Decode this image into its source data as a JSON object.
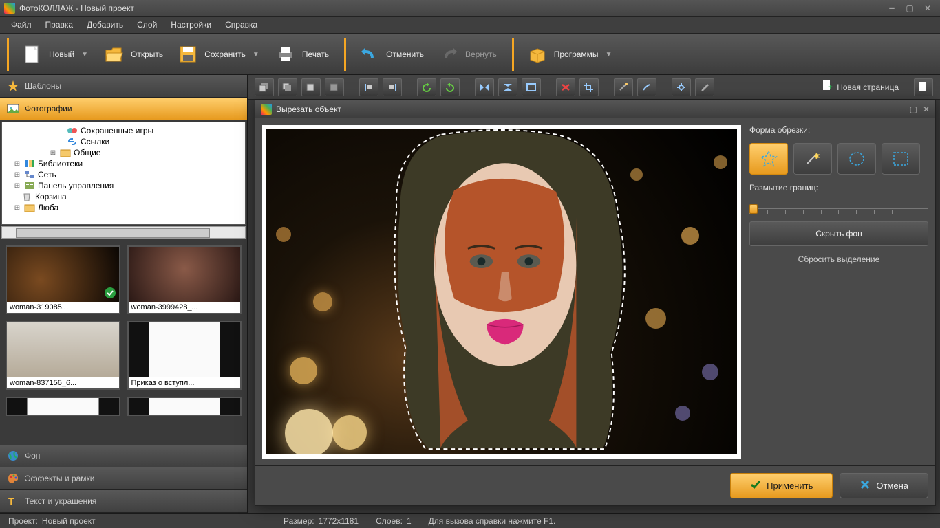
{
  "title": "ФотоКОЛЛАЖ - Новый проект",
  "menu": [
    "Файл",
    "Правка",
    "Добавить",
    "Слой",
    "Настройки",
    "Справка"
  ],
  "toolbar": {
    "new": "Новый",
    "open": "Открыть",
    "save": "Сохранить",
    "print": "Печать",
    "undo": "Отменить",
    "redo": "Вернуть",
    "programs": "Программы"
  },
  "left": {
    "templates": "Шаблоны",
    "photos": "Фотографии",
    "background": "Фон",
    "effects": "Эффекты и рамки",
    "text": "Текст и украшения",
    "tree": {
      "saved_games": "Сохраненные игры",
      "links": "Ссылки",
      "shared": "Общие",
      "libraries": "Библиотеки",
      "network": "Сеть",
      "control_panel": "Панель управления",
      "recycle": "Корзина",
      "lyuba": "Люба"
    },
    "thumbs": [
      "woman-319085...",
      "woman-3999428_...",
      "woman-837156_6...",
      "Приказ о вступл..."
    ]
  },
  "canvasToolbar": {
    "new_page": "Новая страница"
  },
  "dialog": {
    "title": "Вырезать объект",
    "crop_shape": "Форма обрезки:",
    "blur_edges": "Размытие границ:",
    "hide_bg": "Скрыть фон",
    "reset_selection": "Сбросить выделение",
    "apply": "Применить",
    "cancel": "Отмена"
  },
  "status": {
    "project_label": "Проект:",
    "project_name": "Новый проект",
    "size_label": "Размер:",
    "size_value": "1772x1181",
    "layers_label": "Слоев:",
    "layers_value": "1",
    "help": "Для вызова справки нажмите F1."
  }
}
